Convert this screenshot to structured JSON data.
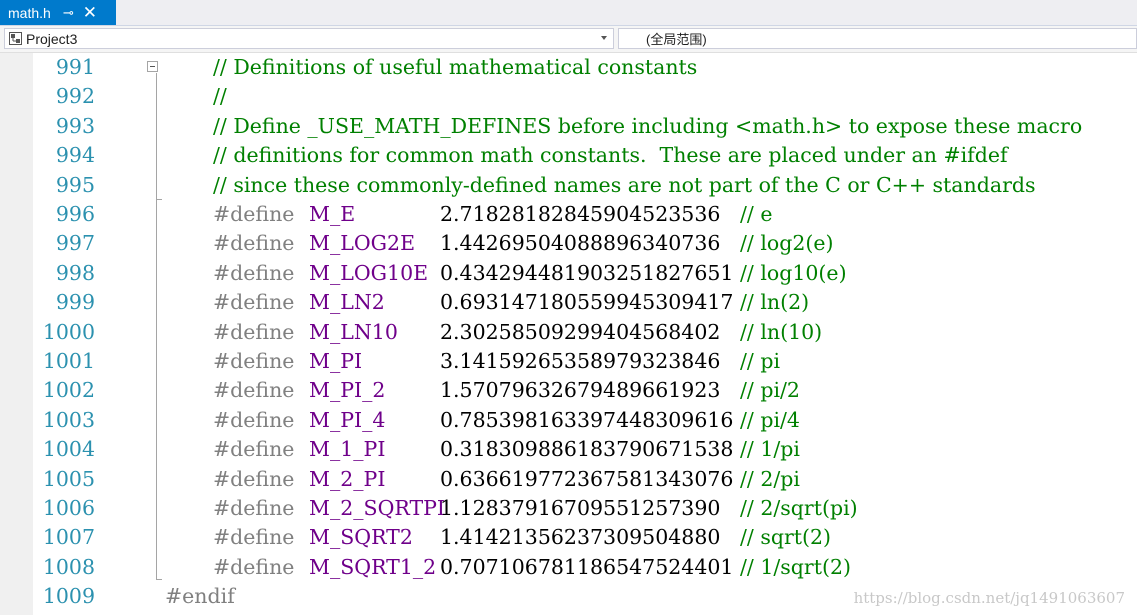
{
  "tab": {
    "filename": "math.h",
    "pin_glyph": "⊸",
    "close_glyph": "✕"
  },
  "navbar": {
    "project": "Project3",
    "scope": "(全局范围)"
  },
  "editor": {
    "lines": [
      {
        "number": "991",
        "kind": "comment",
        "text": "// Definitions of useful mathematical constants"
      },
      {
        "number": "992",
        "kind": "comment",
        "text": "//"
      },
      {
        "number": "993",
        "kind": "comment",
        "text": "// Define _USE_MATH_DEFINES before including <math.h> to expose these macro"
      },
      {
        "number": "994",
        "kind": "comment",
        "text": "// definitions for common math constants.  These are placed under an #ifdef"
      },
      {
        "number": "995",
        "kind": "comment",
        "text": "// since these commonly-defined names are not part of the C or C++ standards"
      },
      {
        "number": "996",
        "kind": "define",
        "directive": "#define",
        "macro": "M_E",
        "value": "2.71828182845904523536",
        "comment": "// e"
      },
      {
        "number": "997",
        "kind": "define",
        "directive": "#define",
        "macro": "M_LOG2E",
        "value": "1.44269504088896340736",
        "comment": "// log2(e)"
      },
      {
        "number": "998",
        "kind": "define",
        "directive": "#define",
        "macro": "M_LOG10E",
        "value": "0.434294481903251827651",
        "comment": "// log10(e)"
      },
      {
        "number": "999",
        "kind": "define",
        "directive": "#define",
        "macro": "M_LN2",
        "value": "0.693147180559945309417",
        "comment": "// ln(2)"
      },
      {
        "number": "1000",
        "kind": "define",
        "directive": "#define",
        "macro": "M_LN10",
        "value": "2.30258509299404568402",
        "comment": "// ln(10)"
      },
      {
        "number": "1001",
        "kind": "define",
        "directive": "#define",
        "macro": "M_PI",
        "value": "3.14159265358979323846",
        "comment": "// pi"
      },
      {
        "number": "1002",
        "kind": "define",
        "directive": "#define",
        "macro": "M_PI_2",
        "value": "1.57079632679489661923",
        "comment": "// pi/2"
      },
      {
        "number": "1003",
        "kind": "define",
        "directive": "#define",
        "macro": "M_PI_4",
        "value": "0.785398163397448309616",
        "comment": "// pi/4"
      },
      {
        "number": "1004",
        "kind": "define",
        "directive": "#define",
        "macro": "M_1_PI",
        "value": "0.318309886183790671538",
        "comment": "// 1/pi"
      },
      {
        "number": "1005",
        "kind": "define",
        "directive": "#define",
        "macro": "M_2_PI",
        "value": "0.636619772367581343076",
        "comment": "// 2/pi"
      },
      {
        "number": "1006",
        "kind": "define",
        "directive": "#define",
        "macro": "M_2_SQRTPI",
        "value": "1.12837916709551257390",
        "comment": "// 2/sqrt(pi)"
      },
      {
        "number": "1007",
        "kind": "define",
        "directive": "#define",
        "macro": "M_SQRT2",
        "value": "1.41421356237309504880",
        "comment": "// sqrt(2)"
      },
      {
        "number": "1008",
        "kind": "define",
        "directive": "#define",
        "macro": "M_SQRT1_2",
        "value": "0.707106781186547524401",
        "comment": "// 1/sqrt(2)"
      },
      {
        "number": "1009",
        "kind": "endif",
        "text": "#endif"
      }
    ]
  },
  "watermark": "https://blog.csdn.net/jq1491063607",
  "colors": {
    "tab_active": "#007acc",
    "line_number": "#2b91af",
    "comment": "#008000",
    "preprocessor": "#808080",
    "macro": "#6f008a"
  }
}
